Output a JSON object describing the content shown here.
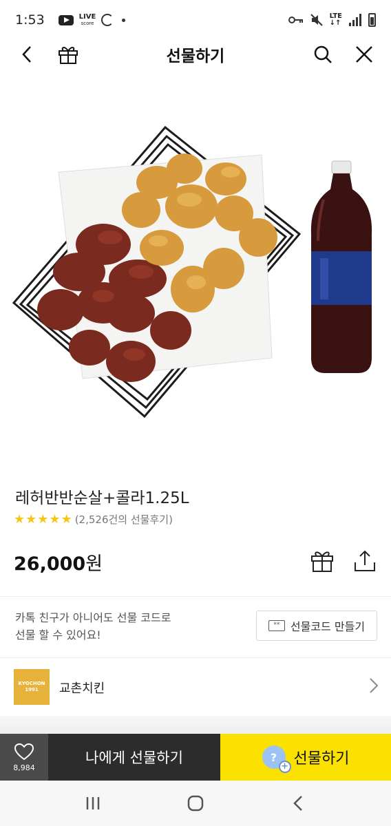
{
  "status_bar": {
    "time": "1:53",
    "live_label": "LIVE",
    "score_label": "score",
    "network_label": "LTE"
  },
  "header": {
    "title": "선물하기"
  },
  "product": {
    "name": "레허반반순살+콜라1.25L",
    "rating_stars": 5,
    "review_count": "(2,526건의 선물후기)",
    "price_value": "26,000",
    "price_unit": "원"
  },
  "gift_code": {
    "notice": "카톡 친구가 아니어도 선물 코드로\n선물 할 수 있어요!",
    "button_label": "선물코드 만들기"
  },
  "brand": {
    "logo_line1": "KYOCHON",
    "logo_line2": "1991",
    "name": "교촌치킨"
  },
  "action_bar": {
    "wish_count": "8,984",
    "self_gift_label": "나에게 선물하기",
    "gift_label": "선물하기",
    "friend_icon_char": "?",
    "gift_button_color": "#fae100"
  },
  "icons": {
    "back": "back-arrow-icon",
    "gift": "gift-icon",
    "search": "search-icon",
    "close": "close-icon",
    "share": "share-icon",
    "heart": "heart-icon",
    "chevron": "chevron-right-icon"
  }
}
